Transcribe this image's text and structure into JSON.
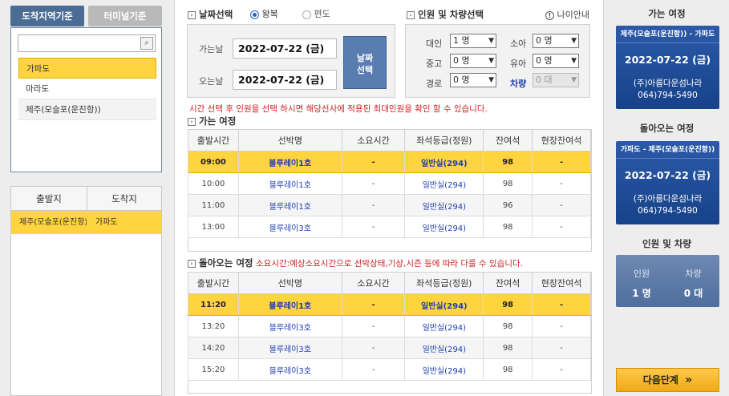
{
  "left": {
    "tabs": [
      "도착지역기준",
      "터미널기준"
    ],
    "search": {
      "value": "",
      "placeholder": ""
    },
    "destinations": [
      "가파도",
      "마라도",
      "제주(모슬포(운진항))"
    ],
    "route_headers": [
      "출발지",
      "도착지"
    ],
    "route": {
      "from": "제주(모슬포(운진항))",
      "to": "가파도"
    }
  },
  "date_section": {
    "title": "날짜선택",
    "trip_types": [
      "왕복",
      "편도"
    ],
    "selected_trip": "왕복",
    "depart_label": "가는날",
    "depart_value": "2022-07-22 (금)",
    "return_label": "오는날",
    "return_value": "2022-07-22 (금)",
    "button": "날짜\n선택"
  },
  "pax_section": {
    "title": "인원 및 차량선택",
    "age_info": "나이안내",
    "fields": [
      {
        "label": "대인",
        "value": "1 명"
      },
      {
        "label": "소아",
        "value": "0 명"
      },
      {
        "label": "중고",
        "value": "0 명"
      },
      {
        "label": "유아",
        "value": "0 명"
      },
      {
        "label": "경로",
        "value": "0 명"
      },
      {
        "label": "차량",
        "value": "0 대"
      }
    ]
  },
  "notice": "시간 선택 후 인원을 선택 하시면 해당선사에 적용된 최대인원을 확인 할 수 있습니다.",
  "outbound": {
    "title": "가는 여정",
    "headers": [
      "출발시간",
      "선박명",
      "소요시간",
      "좌석등급(정원)",
      "잔여석",
      "현장잔여석"
    ],
    "rows": [
      [
        "09:00",
        "블루레이1호",
        "-",
        "일반실(294)",
        "98",
        "-"
      ],
      [
        "10:00",
        "블루레이1호",
        "-",
        "일반실(294)",
        "98",
        "-"
      ],
      [
        "11:00",
        "블루레이1호",
        "-",
        "일반실(294)",
        "96",
        "-"
      ],
      [
        "13:00",
        "블루레이3호",
        "-",
        "일반실(294)",
        "98",
        "-"
      ]
    ]
  },
  "inbound": {
    "title": "돌아오는 여정",
    "notice": "소요시간:예상소요시간으로 선박상태,기상,시즌 등에 따라 다를 수 있습니다.",
    "headers": [
      "출발시간",
      "선박명",
      "소요시간",
      "좌석등급(정원)",
      "잔여석",
      "현장잔여석"
    ],
    "rows": [
      [
        "11:20",
        "블루레이1호",
        "-",
        "일반실(294)",
        "98",
        "-"
      ],
      [
        "13:20",
        "블루레이3호",
        "-",
        "일반실(294)",
        "98",
        "-"
      ],
      [
        "14:20",
        "블루레이3호",
        "-",
        "일반실(294)",
        "98",
        "-"
      ],
      [
        "15:20",
        "블루레이3호",
        "-",
        "일반실(294)",
        "98",
        "-"
      ]
    ]
  },
  "right": {
    "going_title": "가는 여정",
    "going": {
      "route": "제주(모슬포(운진항)) - 가파도",
      "date": "2022-07-22 (금)",
      "operator": "(주)아름다운섬나라",
      "phone": "064)794-5490"
    },
    "return_title": "돌아오는 여정",
    "return": {
      "route": "가파도 - 제주(모슬포(운진항))",
      "date": "2022-07-22 (금)",
      "operator": "(주)아름다운섬나라",
      "phone": "064)794-5490"
    },
    "summary_title": "인원 및 차량",
    "summary": {
      "pax_label": "인원",
      "pax_value": "1 명",
      "car_label": "차량",
      "car_value": "0 대"
    },
    "next_button": "다음단계",
    "next_arrow": "»"
  },
  "colors": {
    "accent_blue": "#17428a",
    "highlight_yellow": "#ffd43f",
    "notice_red": "#cc2222"
  }
}
